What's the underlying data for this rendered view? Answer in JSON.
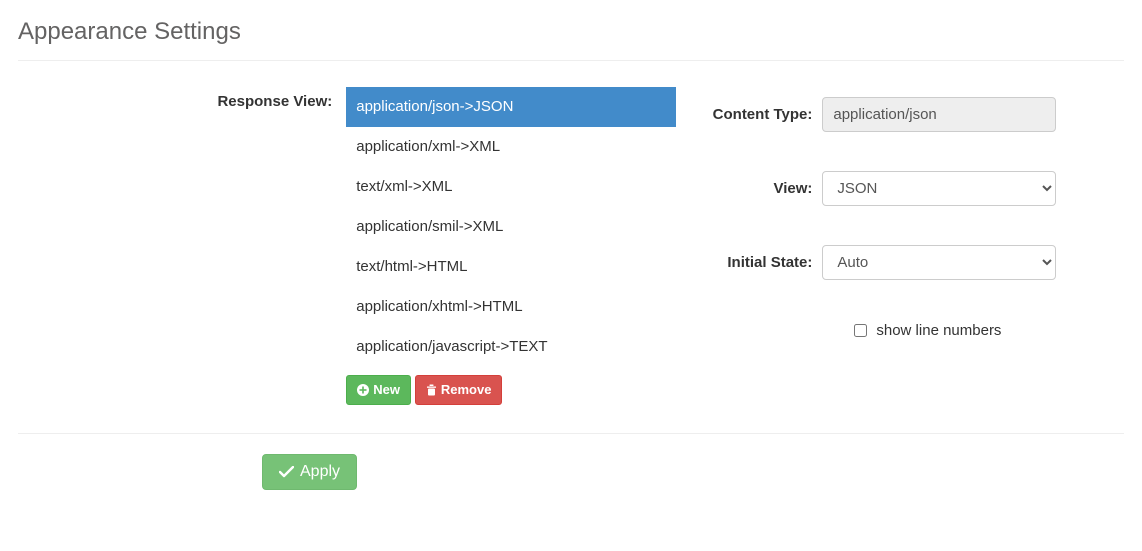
{
  "page": {
    "title": "Appearance Settings"
  },
  "labels": {
    "response_view": "Response View:",
    "content_type": "Content Type:",
    "view": "View:",
    "initial_state": "Initial State:",
    "show_line_numbers": "show line numbers"
  },
  "response_view": {
    "items": [
      "application/json->JSON",
      "application/xml->XML",
      "text/xml->XML",
      "application/smil->XML",
      "text/html->HTML",
      "application/xhtml->HTML",
      "application/javascript->TEXT"
    ],
    "selected_index": 0
  },
  "buttons": {
    "new": "New",
    "remove": "Remove",
    "apply": "Apply"
  },
  "details": {
    "content_type": "application/json",
    "view_selected": "JSON",
    "initial_state_selected": "Auto",
    "show_line_numbers_checked": false
  }
}
